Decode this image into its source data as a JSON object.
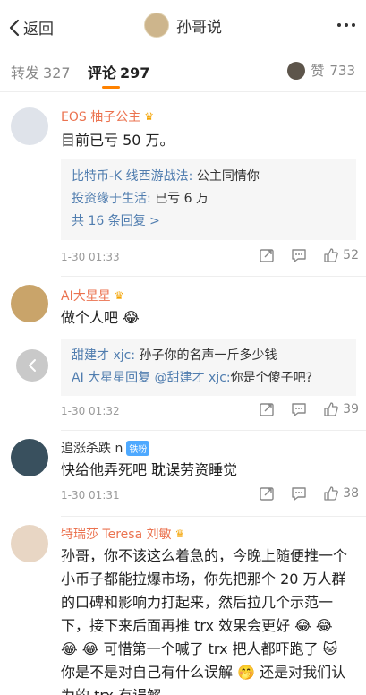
{
  "topbar": {
    "back_label": "返回",
    "title": "孙哥说"
  },
  "tabs": {
    "reposts_label": "转发",
    "reposts_count": "327",
    "comments_label": "评论",
    "comments_count": "297",
    "likes_label": "赞",
    "likes_count": "733"
  },
  "comments": [
    {
      "name": "EOS 柚子公主",
      "text": "目前已亏 50 万。",
      "replies": [
        {
          "user": "比特币-K 线西游战法:",
          "text": " 公主同情你"
        },
        {
          "user": "投资缘于生活:",
          "text": " 已亏 6 万"
        }
      ],
      "more_replies": "共 16 条回复 >",
      "time": "1-30 01:33",
      "likes": "52"
    },
    {
      "name": "AI大星星",
      "text": "做个人吧 😂",
      "replies": [
        {
          "user": "甜建才 xjc:",
          "text": " 孙子你的名声一斤多少钱"
        },
        {
          "user": "AI 大星星回复 @甜建才 xjc:",
          "text": "你是个傻子吧?"
        }
      ],
      "time": "1-30 01:32",
      "likes": "39"
    },
    {
      "name": "追涨杀跌 n",
      "badge": "铁粉",
      "text": "快给他弄死吧  耽误劳资睡觉",
      "time": "1-30 01:31",
      "likes": "38"
    },
    {
      "name": "特瑞莎 Teresa 刘敏",
      "text": "孙哥，你不该这么着急的，今晚上随便推一个小币子都能拉爆市场，你先把那个 20 万人群的口碑和影响力打起来，然后拉几个示范一下，接下来后面再推 trx 效果会更好 😂 😂 😂 😂 可惜第一个喊了 trx 把人都吓跑了 🐱 你是不是对自己有什么误解 🤭 还是对我们认为的 trx 有误解"
    }
  ],
  "colors": {
    "name_orange": "#eb7350",
    "link_blue": "#507daf",
    "accent": "#ff8200"
  }
}
